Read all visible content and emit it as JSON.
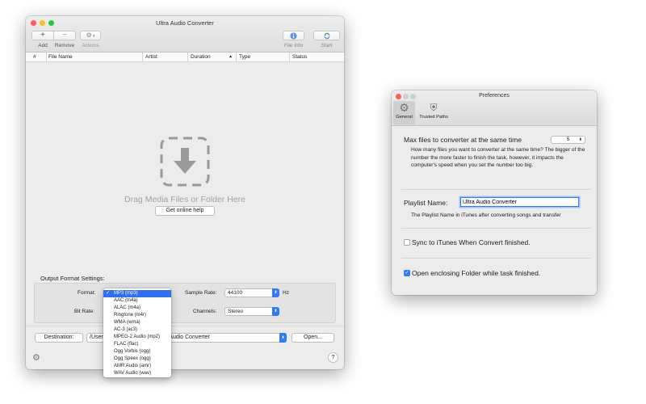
{
  "main": {
    "title": "Ultra Audio Converter",
    "toolbar": {
      "add_label": "Add",
      "remove_label": "Remove",
      "actions_label": "Actions",
      "fileinfo_label": "File Info",
      "start_label": "Start"
    },
    "columns": [
      "#",
      "File Name",
      "Artist",
      "Duration",
      "Type",
      "Status"
    ],
    "drop_text": "Drag Media Files or Folder Here",
    "online_help": "Get online help",
    "output": {
      "heading": "Output Format Settings:",
      "format_label": "Format:",
      "bitrate_label": "Bit Rate:",
      "samplerate_label": "Sample Rate:",
      "samplerate_value": "44100",
      "samplerate_unit": "Hz",
      "channels_label": "Channels:",
      "channels_value": "Stereo"
    },
    "destination_button": "Destination:",
    "destination_path_left": "/User",
    "destination_path_right": "ltra Audio Converter",
    "open_button": "Open...",
    "help": "?"
  },
  "format_menu": {
    "items": [
      "MP3 (mp3)",
      "AAC (m4a)",
      "ALAC (m4a)",
      "Ringtone (m4r)",
      "WMA (wma)",
      "AC-3 (ac3)",
      "MPEG-2 Audio (mp2)",
      "FLAC (flac)",
      "Ogg Vorbis (ogg)",
      "Ogg Speex (ogg)",
      "AMR Audio (amr)",
      "WAV Audio (wav)"
    ],
    "selected_index": 0
  },
  "prefs": {
    "title": "Preferences",
    "tab_general": "General",
    "tab_trusted": "Trusted Paths",
    "max_files_label": "Max files to converter at the same time",
    "max_files_value": "5",
    "max_files_desc": "How many files you want to converter at the same time? The bigger of the number the more faster to finish the task, however, it impacts the computer's speed when you set the number too big.",
    "playlist_label": "Playlist Name:",
    "playlist_value": "Ultra Audio Converter",
    "playlist_desc": "The Playlist Name in iTunes after converting songs and transfer",
    "sync_label": "Sync to iTunes When Convert finished.",
    "sync_checked": false,
    "open_folder_label": "Open enclosing Folder while task finished.",
    "open_folder_checked": true
  },
  "colors": {
    "accent": "#2f7cf6",
    "close": "#fc5f57",
    "minimize": "#fdbc2e",
    "zoom": "#28c840"
  }
}
